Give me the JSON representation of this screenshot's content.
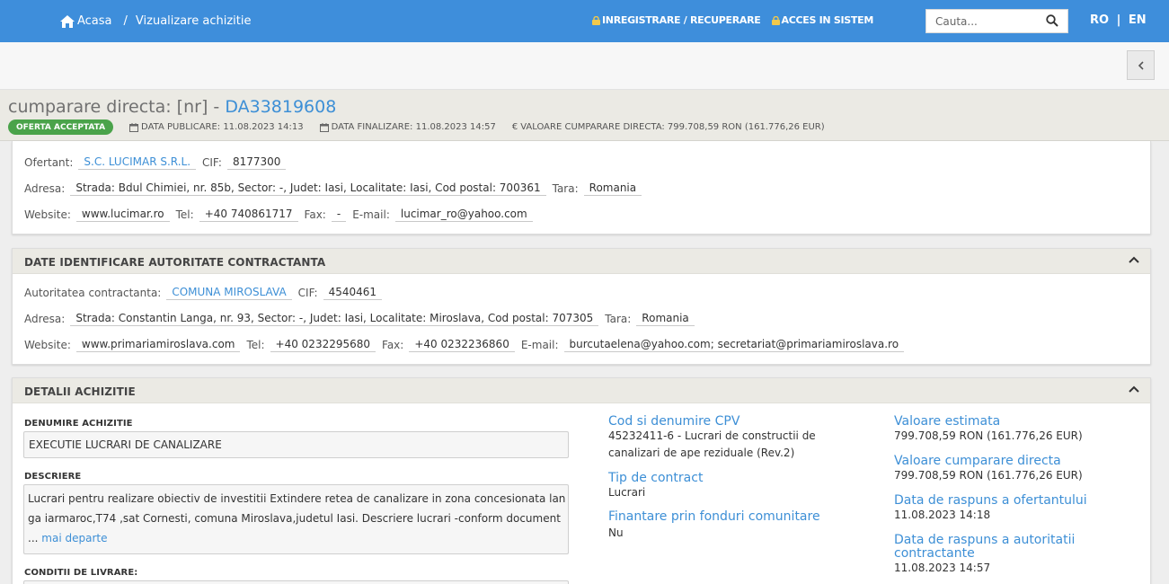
{
  "nav": {
    "home_label": "Acasa",
    "separator": "/",
    "current": "Vizualizare achizitie",
    "register_label": "INREGISTRARE / RECUPERARE",
    "login_label": "ACCES IN SISTEM",
    "search_placeholder": "Cauta...",
    "lang_ro": "RO",
    "lang_sep": "|",
    "lang_en": "EN"
  },
  "header": {
    "title_prefix": "cumparare directa: [nr] -",
    "code": "DA33819608",
    "status": "OFERTA ACCEPTATA",
    "publish": "DATA PUBLICARE: 11.08.2023 14:13",
    "finalize": "DATA FINALIZARE: 11.08.2023 14:57",
    "value": "VALOARE CUMPARARE DIRECTA: 799.708,59  RON (161.776,26  EUR)"
  },
  "bidder": {
    "ofertant_label": "Ofertant:",
    "ofertant": "S.C. LUCIMAR S.R.L.",
    "cif_label": "CIF:",
    "cif": "8177300",
    "adresa_label": "Adresa:",
    "adresa": "Strada: Bdul Chimiei, nr. 85b, Sector: -, Judet: Iasi, Localitate: Iasi, Cod postal: 700361",
    "tara_label": "Tara:",
    "tara": "Romania",
    "website_label": "Website:",
    "website": "www.lucimar.ro",
    "tel_label": "Tel:",
    "tel": "+40 740861717",
    "fax_label": "Fax:",
    "fax": "-",
    "email_label": "E-mail:",
    "email": "lucimar_ro@yahoo.com"
  },
  "authority": {
    "section_title": "DATE IDENTIFICARE AUTORITATE CONTRACTANTA",
    "name_label": "Autoritatea contractanta:",
    "name": "COMUNA MIROSLAVA",
    "cif_label": "CIF:",
    "cif": "4540461",
    "adresa_label": "Adresa:",
    "adresa": "Strada: Constantin Langa, nr. 93, Sector: -, Judet: Iasi, Localitate: Miroslava, Cod postal: 707305",
    "tara_label": "Tara:",
    "tara": "Romania",
    "website_label": "Website:",
    "website": "www.primariamiroslava.com",
    "tel_label": "Tel:",
    "tel": "+40 0232295680",
    "fax_label": "Fax:",
    "fax": "+40 0232236860",
    "email_label": "E-mail:",
    "email": "burcutaelena@yahoo.com; secretariat@primariamiroslava.ro"
  },
  "details": {
    "section_title": "DETALII ACHIZITIE",
    "denumire_label": "DENUMIRE ACHIZITIE",
    "denumire": "EXECUTIE LUCRARI DE CANALIZARE",
    "descriere_label": "DESCRIERE",
    "descriere_line1": "Lucrari pentru realizare obiectiv de investitii Extindere retea de canalizare in zona concesionata lan",
    "descriere_line2": "ga iarmaroc,T74 ,sat Cornesti, comuna Miroslava,judetul Iasi. Descriere lucrari -conform document",
    "descriere_ellipsis": "...",
    "more_label": "mai departe",
    "conditii_label": "CONDITII DE LIVRARE:",
    "cpv_label": "Cod si denumire CPV",
    "cpv_line1": "45232411-6 - Lucrari de constructii de",
    "cpv_line2": "canalizari de ape reziduale (Rev.2)",
    "tip_label": "Tip de contract",
    "tip": "Lucrari",
    "finantare_label": "Finantare prin fonduri comunitare",
    "finantare": "Nu",
    "val_est_label": "Valoare estimata",
    "val_est": "799.708,59  RON (161.776,26  EUR)",
    "val_cd_label": "Valoare cumparare directa",
    "val_cd": "799.708,59  RON (161.776,26  EUR)",
    "resp_of_label": "Data de raspuns a ofertantului",
    "resp_of": "11.08.2023 14:18",
    "resp_auth_label_1": "Data de raspuns a autoritatii",
    "resp_auth_label_2": "contractante",
    "resp_auth": "11.08.2023 14:57"
  }
}
